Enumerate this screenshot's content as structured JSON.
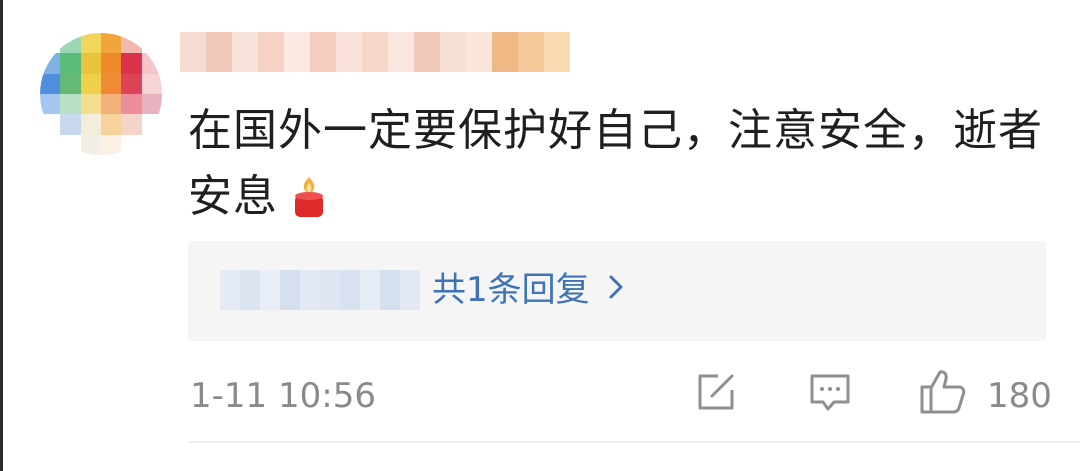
{
  "comment": {
    "text": "在国外一定要保护好自己，注意安全，逝者安息",
    "emoji": "candle-icon"
  },
  "reply": {
    "summary": "共1条回复",
    "chevron": "chevron-right-icon"
  },
  "footer": {
    "timestamp": "1-11 10:56",
    "like_count": "180"
  },
  "colors": {
    "link": "#3e74b6",
    "meta_text": "#8a8a8a",
    "reply_bg": "#f5f5f5"
  }
}
